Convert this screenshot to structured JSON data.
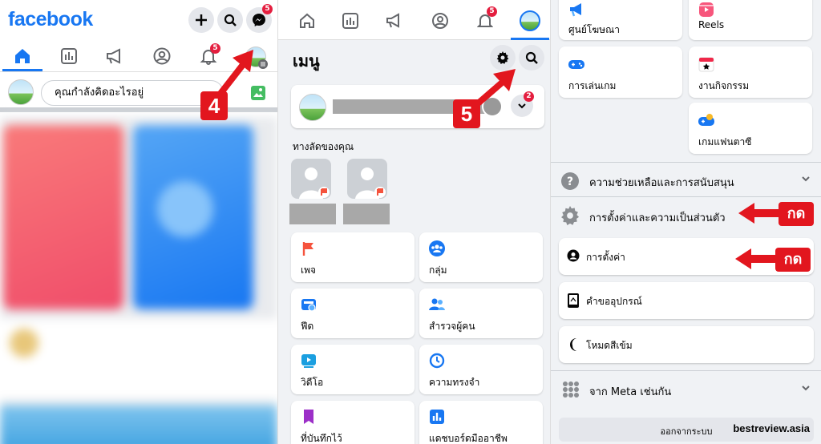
{
  "screen1": {
    "logo": "facebook",
    "notif_badge": "5",
    "messenger_badge": "5",
    "composer_placeholder": "คุณกำลังคิดอะไรอยู่",
    "step": "4"
  },
  "screen2": {
    "notif_badge": "5",
    "menu_title": "เมนู",
    "profile_badge": "2",
    "step": "5",
    "shortcuts_label": "ทางลัดของคุณ",
    "tiles": [
      {
        "label": "เพจ",
        "icon": "flag-icon",
        "color": "#f5533d"
      },
      {
        "label": "กลุ่ม",
        "icon": "groups-icon",
        "color": "#1877f2"
      },
      {
        "label": "ฟีด",
        "icon": "feed-icon",
        "color": "#1877f2"
      },
      {
        "label": "สำรวจผู้คน",
        "icon": "friends-icon",
        "color": "#1877f2"
      },
      {
        "label": "วิดีโอ",
        "icon": "video-icon",
        "color": "#1b9fe0"
      },
      {
        "label": "ความทรงจำ",
        "icon": "memories-icon",
        "color": "#1877f2"
      },
      {
        "label": "ที่บันทึกไว้",
        "icon": "saved-icon",
        "color": "#9c2fc8"
      },
      {
        "label": "แดชบอร์ดมืออาชีพ",
        "icon": "dashboard-icon",
        "color": "#1877f2"
      }
    ]
  },
  "screen3": {
    "tiles": [
      {
        "label": "ศูนย์โฆษณา",
        "icon": "ads-icon"
      },
      {
        "label": "Reels",
        "icon": "reels-icon"
      },
      {
        "label": "การเล่นเกม",
        "icon": "gaming-icon"
      },
      {
        "label": "งานกิจกรรม",
        "icon": "events-icon"
      },
      {
        "label": "เกมแฟนตาซี",
        "icon": "fantasy-games-icon"
      }
    ],
    "help_section": "ความช่วยเหลือและการสนับสนุน",
    "settings_section": "การตั้งค่าและความเป็นส่วนตัว",
    "rows": [
      {
        "label": "การตั้งค่า",
        "icon": "user-settings-icon"
      },
      {
        "label": "คำขออุปกรณ์",
        "icon": "device-icon"
      },
      {
        "label": "โหมดสีเข้ม",
        "icon": "moon-icon"
      }
    ],
    "meta_section": "จาก Meta เช่นกัน",
    "logout": "ออกจากระบบ",
    "press_label": "กด",
    "watermark": "bestreview.asia"
  },
  "colors": {
    "brand": "#1877f2",
    "annotation_red": "#e2161e"
  }
}
